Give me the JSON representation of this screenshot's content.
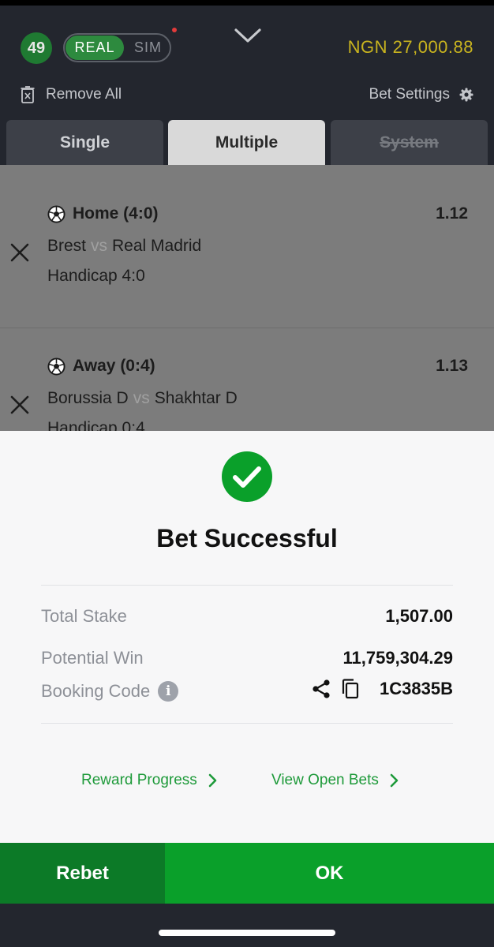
{
  "header": {
    "bet_count": "49",
    "mode_real": "REAL",
    "mode_sim": "SIM",
    "balance": "NGN 27,000.88",
    "remove_all": "Remove All",
    "bet_settings": "Bet Settings"
  },
  "tabs": [
    {
      "label": "Single"
    },
    {
      "label": "Multiple"
    },
    {
      "label": "System"
    }
  ],
  "bets": [
    {
      "pick": "Home (4:0)",
      "odds": "1.12",
      "home": "Brest",
      "vs": "vs",
      "away": "Real Madrid",
      "market": "Handicap 4:0"
    },
    {
      "pick": "Away (0:4)",
      "odds": "1.13",
      "home": "Borussia D",
      "vs": "vs",
      "away": "Shakhtar D",
      "market": "Handicap 0:4"
    }
  ],
  "modal": {
    "title": "Bet Successful",
    "total_stake_label": "Total Stake",
    "total_stake_value": "1,507.00",
    "potential_win_label": "Potential Win",
    "potential_win_value": "11,759,304.29",
    "booking_code_label": "Booking Code",
    "booking_code_value": "1C3835B",
    "reward_progress": "Reward Progress",
    "view_open_bets": "View Open Bets"
  },
  "buttons": {
    "rebet": "Rebet",
    "ok": "OK"
  },
  "colors": {
    "accent_green": "#0aa02a",
    "dark_green": "#0c7a27",
    "balance_yellow": "#c9b41f",
    "background": "#23262e"
  }
}
